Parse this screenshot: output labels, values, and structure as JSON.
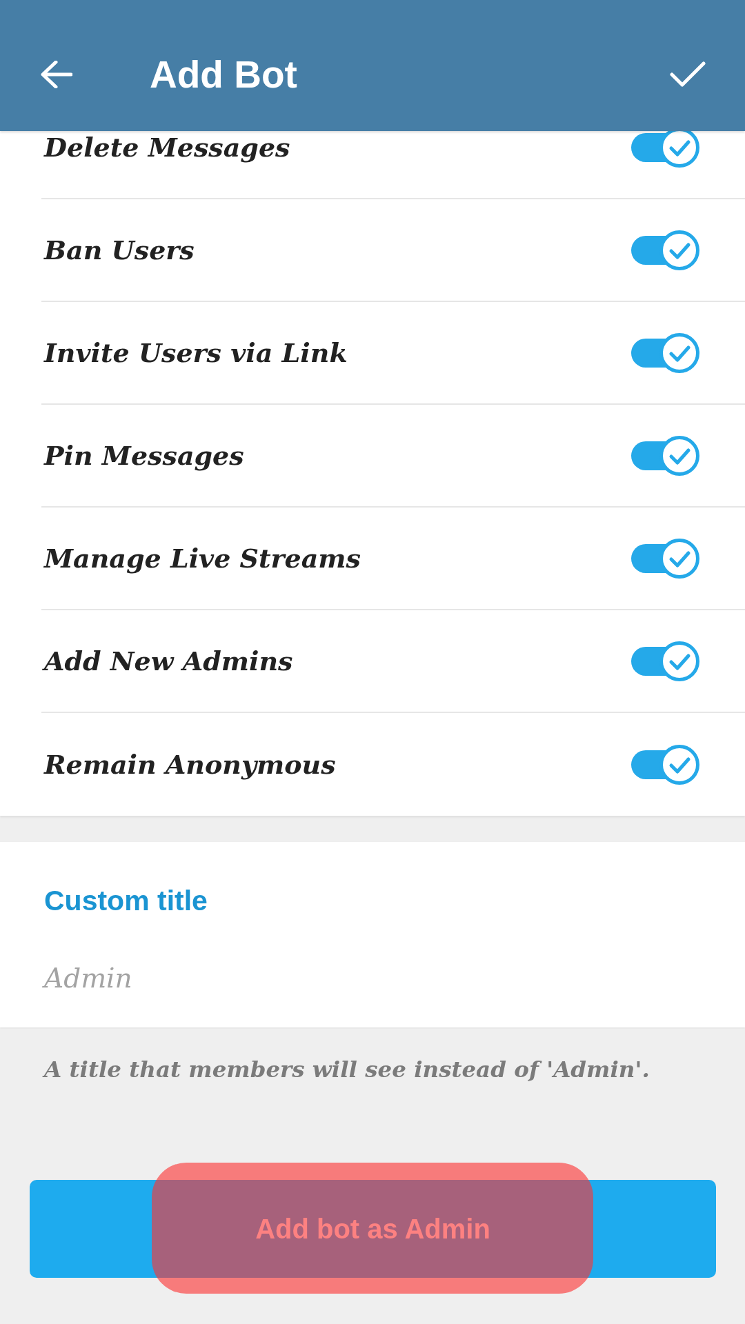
{
  "header": {
    "title": "Add Bot"
  },
  "permissions": [
    {
      "label": "Delete Messages",
      "on": true
    },
    {
      "label": "Ban Users",
      "on": true
    },
    {
      "label": "Invite Users via Link",
      "on": true
    },
    {
      "label": "Pin Messages",
      "on": true
    },
    {
      "label": "Manage Live Streams",
      "on": true
    },
    {
      "label": "Add New Admins",
      "on": true
    },
    {
      "label": "Remain Anonymous",
      "on": true
    }
  ],
  "custom_title": {
    "label": "Custom title",
    "placeholder": "Admin",
    "hint": "A title that members will see instead of 'Admin'."
  },
  "action_button": {
    "label": "Add bot as Admin",
    "highlighted": true
  }
}
